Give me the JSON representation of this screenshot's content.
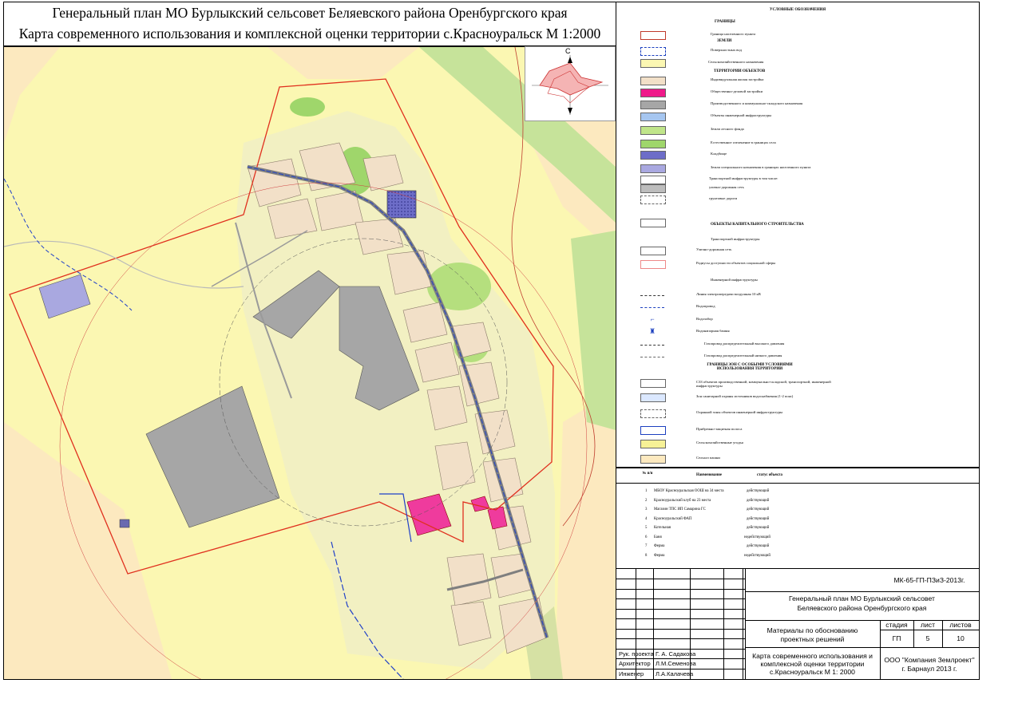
{
  "title": {
    "line1": "Генеральный план МО Бурлыкский сельсовет Беляевского района Оренбургского края",
    "line2": "Карта современного использования и комплексной оценки территории с.Красноуральск М 1:2000"
  },
  "compass": {
    "north_label": "С"
  },
  "colors": {
    "agri": "#fbf7b2",
    "agri_light": "#f3f0a0",
    "field": "#fce9bf",
    "forest": "#c0e58a",
    "forest_dark": "#9fd66b",
    "greenbelt": "#d6e1a4",
    "village_fill": "#f3e3c9",
    "residential": "#f2e0c8",
    "industrial": "#a6a6a6",
    "public": "#ef3b9d",
    "cemetery": "#4a4aa8",
    "special": "#a9a8e0",
    "boundary": "#e0301e",
    "water_line": "#1b3fbf",
    "road": "#7f7f7f"
  },
  "legend": {
    "title": "УСЛОВНЫЕ ОБОЗНАЧЕНИЯ",
    "sections": [
      {
        "heading": "ГРАНИЦЫ",
        "items": [
          {
            "label": "Граница населенного пункта",
            "icon": "red-boundary-swatch"
          }
        ]
      },
      {
        "heading": "ЗЕМЛИ",
        "items": [
          {
            "label": "Поверхностных вод",
            "icon": "water-swatch"
          },
          {
            "label": "Сельскохозяйственного назначения",
            "icon": "agri-swatch"
          }
        ]
      },
      {
        "heading": "ТЕРРИТОРИИ ОБЪЕКТОВ",
        "items": [
          {
            "label": "Индивидуальная жилая застройка",
            "icon": "residential-swatch"
          },
          {
            "label": "Общественно-деловой застройки",
            "icon": "public-swatch"
          },
          {
            "label": "Производственного и коммунально-складского назначения",
            "icon": "industrial-swatch"
          },
          {
            "label": "Объекты инженерной инфраструктуры",
            "icon": "engineering-swatch"
          },
          {
            "label": "Земли лесного фонда",
            "icon": "forest-swatch"
          },
          {
            "label": "Естественное озеленение в границах села",
            "icon": "greenery-swatch"
          },
          {
            "label": "Кладбище",
            "icon": "cemetery-swatch"
          },
          {
            "label": "Земли специального назначения в границах населенного пункта",
            "icon": "special-swatch"
          },
          {
            "label": "Транспортной инфраструктуры в том числе:",
            "icon": "transport-swatch"
          },
          {
            "label": "улично-дорожная сеть",
            "icon": "street-swatch"
          },
          {
            "label": "грунтовые дороги",
            "icon": "dirt-road-swatch"
          }
        ]
      },
      {
        "heading": "ОБЪЕКТЫ КАПИТАЛЬНОГО СТРОИТЕЛЬСТВА",
        "items": [
          {
            "label": "Транспортной инфраструктуры",
            "icon": ""
          },
          {
            "label": "Улично-дорожная сеть",
            "icon": "street-line-swatch"
          },
          {
            "label": "Радиусы доступности объектов социальной сферы",
            "icon": "radius-swatch"
          },
          {
            "label": "Инженерной инфраструктуры",
            "icon": ""
          },
          {
            "label": "Линия электропередачи воздушная 10 кВ",
            "icon": "power-line-swatch"
          },
          {
            "label": "Водопровод",
            "icon": "water-pipe-swatch"
          },
          {
            "label": "Водозабор",
            "icon": "water-intake-icon"
          },
          {
            "label": "Водонапорная башня",
            "icon": "water-tower-icon"
          },
          {
            "label": "Газопровод распределительный высокого давления",
            "icon": "gas-high-swatch"
          },
          {
            "label": "Газопровод распределительный низкого давления",
            "icon": "gas-low-swatch"
          }
        ]
      },
      {
        "heading": "ГРАНИЦЫ ЗОН С ОСОБЫМИ УСЛОВИЯМИ ИСПОЛЬЗОВАНИЯ ТЕРРИТОРИИ",
        "items": [
          {
            "label": "СЗЗ объектов производственной, коммунально-складской, транспортной, инженерной инфраструктуры",
            "icon": "sanitary-zone-swatch"
          },
          {
            "label": "Зон санитарной охраны источников водоснабжения (1-2 пояс)",
            "icon": "water-protection-swatch"
          },
          {
            "label": "Охранной зоны объектов инженерной инфраструктуры",
            "icon": "security-zone-swatch"
          },
          {
            "label": "Прибрежно-защитная полоса",
            "icon": "coastal-swatch"
          },
          {
            "label": "Сельскохозяйственные угодья",
            "icon": "farmland-swatch"
          },
          {
            "label": "Сельхоз пашни",
            "icon": "arable-swatch"
          }
        ]
      }
    ]
  },
  "objects_table": {
    "headers": {
      "num": "№ п/п",
      "name": "Наименование",
      "status": "статус объекта"
    },
    "rows": [
      {
        "num": "1",
        "name": "МБОУ Красноуральская ООШ на 34 места",
        "status": "действующий"
      },
      {
        "num": "2",
        "name": "Красноуральский клуб на 23 места",
        "status": "действующий"
      },
      {
        "num": "3",
        "name": "Магазин ТПС ИП Самарина ГС",
        "status": "действующий"
      },
      {
        "num": "4",
        "name": "Красноуральский ФАП",
        "status": "действующий"
      },
      {
        "num": "5",
        "name": "Котельная",
        "status": "действующий"
      },
      {
        "num": "6",
        "name": "Баня",
        "status": "недействующий"
      },
      {
        "num": "7",
        "name": "Ферма",
        "status": "действующий"
      },
      {
        "num": "8",
        "name": "Ферма",
        "status": "недействующий"
      }
    ]
  },
  "stamp": {
    "doc_code": "МК-65-ГП-ПЗиЗ-2013г.",
    "project_title_1": "Генеральный план МО Бурлыкский сельсовет",
    "project_title_2": "Беляевского района Оренбургского края",
    "materials_1": "Материалы по обоснованию",
    "materials_2": "проектных решений",
    "stage_header": "стадия",
    "sheet_header": "лист",
    "sheets_header": "листов",
    "stage": "ГП",
    "sheet": "5",
    "sheets": "10",
    "map_title_1": "Карта современного использования и",
    "map_title_2": "комплексной оценки территории",
    "map_title_3": "с.Красноуральск М 1: 2000",
    "company_1": "ООО \"Компания Землроект\"",
    "company_2": "г. Барнаул 2013 г.",
    "signatures": [
      {
        "role": "Рук. проекта",
        "name": "Г. А. Садакова"
      },
      {
        "role": "Архитектор",
        "name": "Л.М.Семенова"
      },
      {
        "role": "Инженер",
        "name": "Л.А.Калачева"
      }
    ]
  }
}
